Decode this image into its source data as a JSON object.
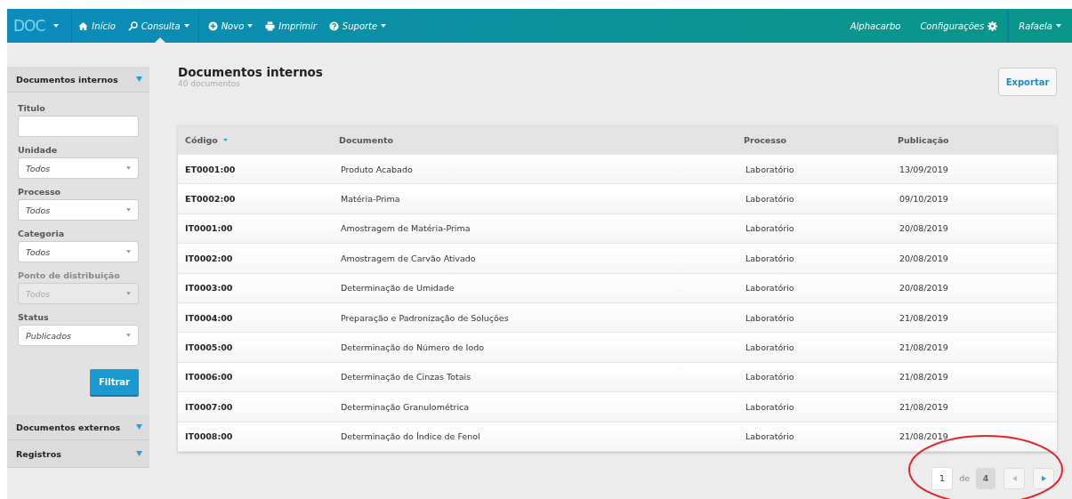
{
  "navbar": {
    "logo": "DOC",
    "items": [
      {
        "kind": "home",
        "label": "Início",
        "dropdown": false,
        "selected": false
      },
      {
        "kind": "search",
        "label": "Consulta",
        "dropdown": true,
        "selected": true
      },
      {
        "kind": "plus",
        "label": "Novo",
        "dropdown": true,
        "selected": false
      },
      {
        "kind": "print",
        "label": "Imprimir",
        "dropdown": false,
        "selected": false
      },
      {
        "kind": "help",
        "label": "Suporte",
        "dropdown": true,
        "selected": false
      }
    ],
    "right": [
      {
        "kind": "plain",
        "label": "Alphacarbo"
      },
      {
        "kind": "gear",
        "label": "Configurações"
      },
      {
        "kind": "user",
        "label": "Rafaela"
      }
    ]
  },
  "sidebar": {
    "sections": [
      {
        "title": "Documentos internos",
        "filters": [
          {
            "kind": "text",
            "label": "Titulo"
          },
          {
            "kind": "select",
            "label": "Unidade",
            "value": "Todos",
            "disabled": false
          },
          {
            "kind": "select",
            "label": "Processo",
            "value": "Todos",
            "disabled": false
          },
          {
            "kind": "select",
            "label": "Categoria",
            "value": "Todos",
            "disabled": false
          },
          {
            "kind": "select",
            "label": "Ponto de distribuição",
            "value": "Todos",
            "disabled": true
          },
          {
            "kind": "select",
            "label": "Status",
            "value": "Publicados",
            "disabled": false
          }
        ],
        "button": "Filtrar"
      },
      {
        "title": "Documentos externos"
      },
      {
        "title": "Registros"
      }
    ]
  },
  "main": {
    "title": "Documentos internos",
    "subtitle": "40 documentos",
    "export_button": "Exportar"
  },
  "table": {
    "columns": [
      {
        "label": "Código",
        "sorted": true
      },
      {
        "label": "Documento",
        "sorted": false
      },
      {
        "label": "Processo",
        "sorted": false
      },
      {
        "label": "Publicação",
        "sorted": false
      }
    ],
    "rows": [
      [
        "ET0001:00",
        "Produto Acabado",
        "Laboratório",
        "13/09/2019"
      ],
      [
        "ET0002:00",
        "Matéria-Prima",
        "Laboratório",
        "09/10/2019"
      ],
      [
        "IT0001:00",
        "Amostragem de Matéria-Prima",
        "Laboratório",
        "20/08/2019"
      ],
      [
        "IT0002:00",
        "Amostragem de Carvão Ativado",
        "Laboratório",
        "20/08/2019"
      ],
      [
        "IT0003:00",
        "Determinação de Umidade",
        "Laboratório",
        "20/08/2019"
      ],
      [
        "IT0004:00",
        "Preparação e Padronização de Soluções",
        "Laboratório",
        "21/08/2019"
      ],
      [
        "IT0005:00",
        "Determinação do Número de Iodo",
        "Laboratório",
        "21/08/2019"
      ],
      [
        "IT0006:00",
        "Determinação de Cinzas Totais",
        "Laboratório",
        "21/08/2019"
      ],
      [
        "IT0007:00",
        "Determinação Granulométrica",
        "Laboratório",
        "21/08/2019"
      ],
      [
        "IT0008:00",
        "Determinação do Índice de Fenol",
        "Laboratório",
        "21/08/2019"
      ]
    ]
  },
  "pagination": {
    "page": "1",
    "separator": "de",
    "total": "4",
    "prev_disabled": true,
    "next_disabled": false
  },
  "annotation": {
    "kind": "ellipse"
  }
}
